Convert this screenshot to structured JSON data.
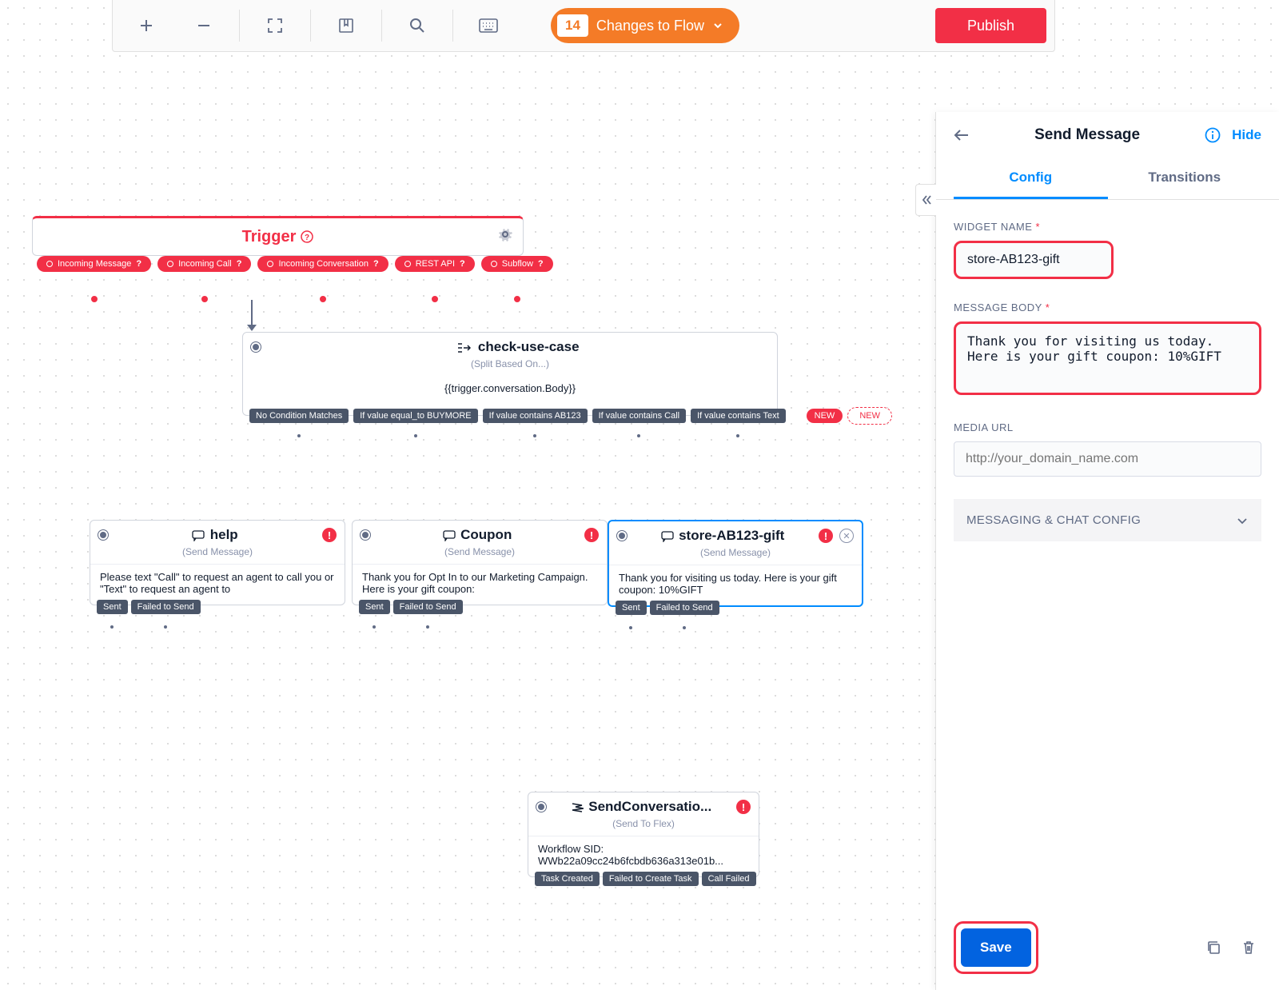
{
  "toolbar": {
    "changes_count": "14",
    "changes_label": "Changes to Flow",
    "publish": "Publish"
  },
  "panel": {
    "title": "Send Message",
    "hide": "Hide",
    "tabs": {
      "config": "Config",
      "transitions": "Transitions"
    },
    "widget_name_label": "WIDGET NAME",
    "widget_name_value": "store-AB123-gift",
    "message_body_label": "MESSAGE BODY",
    "message_body_value": "Thank you for visiting us today. Here is your gift coupon: 10%GIFT",
    "media_url_label": "MEDIA URL",
    "media_url_placeholder": "http://your_domain_name.com",
    "accordion_label": "MESSAGING & CHAT CONFIG",
    "save": "Save"
  },
  "flow": {
    "trigger": {
      "title": "Trigger",
      "pills": [
        "Incoming Message",
        "Incoming Call",
        "Incoming Conversation",
        "REST API",
        "Subflow"
      ]
    },
    "split": {
      "title": "check-use-case",
      "subtitle": "(Split Based On...)",
      "expr": "{{trigger.conversation.Body}}",
      "ports": [
        "No Condition Matches",
        "If value equal_to BUYMORE",
        "If value contains AB123",
        "If value contains Call",
        "If value contains Text"
      ],
      "new": "NEW"
    },
    "help": {
      "title": "help",
      "subtitle": "(Send Message)",
      "body": "Please text \"Call\" to request an agent to call you or \"Text\" to request an agent to",
      "ports": [
        "Sent",
        "Failed to Send"
      ]
    },
    "coupon": {
      "title": "Coupon",
      "subtitle": "(Send Message)",
      "body": "Thank you for Opt In to our Marketing Campaign. Here is your gift coupon:",
      "ports": [
        "Sent",
        "Failed to Send"
      ]
    },
    "gift": {
      "title": "store-AB123-gift",
      "subtitle": "(Send Message)",
      "body": "Thank you for visiting us today. Here is your gift coupon: 10%GIFT",
      "ports": [
        "Sent",
        "Failed to Send"
      ]
    },
    "flex": {
      "title": "SendConversatio...",
      "subtitle": "(Send To Flex)",
      "body_label": "Workflow SID:",
      "body_value": "WWb22a09cc24b6fcbdb636a313e01b...",
      "ports": [
        "Task Created",
        "Failed to Create Task",
        "Call Failed"
      ]
    }
  }
}
